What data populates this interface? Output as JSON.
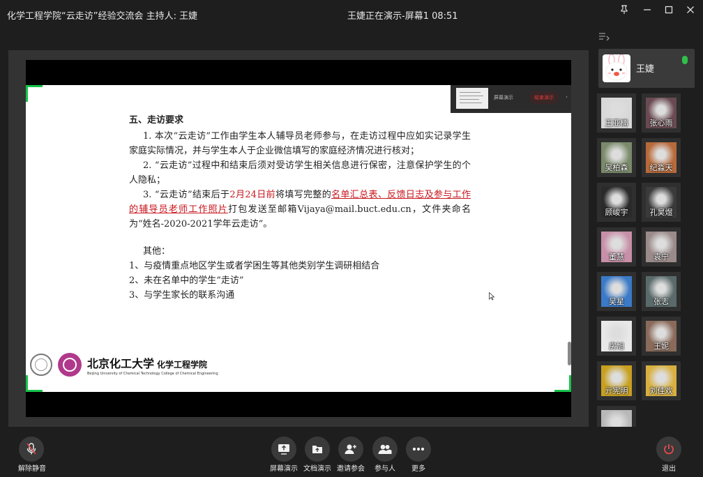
{
  "app": {
    "meeting_title": "化学工程学院“云走访”经验交流会   主持人: 王婕",
    "window_title": "王婕正在演示-屏幕1 08:51",
    "win_icons": {
      "pin": "pin-icon",
      "minimize": "minimize-icon",
      "maximize": "maximize-icon",
      "close": "close-icon"
    }
  },
  "slide": {
    "heading": "五、走访要求",
    "p1": "1. 本次“云走访”工作由学生本人辅导员老师参与，在走访过程中应如实记录学生家庭实际情况，并与学生本人于企业微信填写的家庭经济情况进行核对；",
    "p2": "2. “云走访”过程中和结束后须对受访学生相关信息进行保密，注意保护学生的个人隐私；",
    "p3_a": "3. “云走访”结束后于",
    "p3_date": "2月24日前",
    "p3_b": "将填写完整的",
    "p3_link": "名单汇总表、反馈日志及参与工作的辅导员老师工作照片",
    "p3_c": "打包发送至邮箱Vijaya@mail.buct.edu.cn，文件夹命名为“姓名-2020-2021学年云走访”。",
    "others_label": "其他：",
    "others": [
      "1、与疫情重点地区学生或者学困生等其他类别学生调研相结合",
      "2、未在名单中的学生“走访”",
      "3、与学生家长的联系沟通"
    ],
    "university_cn": "北京化工大学",
    "college_cn": "化学工程学院",
    "university_en": "Beijing University of Chemical Technology   College of Chemical Engineering",
    "mini_label": "屏幕演示",
    "mini_stop": "结束演示"
  },
  "host": {
    "name": "王婕"
  },
  "participants": [
    {
      "name": "王亚楠",
      "color": "#d8d8d8"
    },
    {
      "name": "张心雨",
      "color": "#6a4a52"
    },
    {
      "name": "吴柏森",
      "color": "#7a8a6a"
    },
    {
      "name": "纪淼天",
      "color": "#b86a3a"
    },
    {
      "name": "顾峻宇",
      "color": "#2a2a2a"
    },
    {
      "name": "孔昊煜",
      "color": "#3a3a3a"
    },
    {
      "name": "董慧",
      "color": "#c890a8"
    },
    {
      "name": "袁宁",
      "color": "#9a8a8a"
    },
    {
      "name": "吴星",
      "color": "#3a7ac8"
    },
    {
      "name": "张志",
      "color": "#5a6a6a"
    },
    {
      "name": "房旭",
      "color": "#e8e8e8"
    },
    {
      "name": "王妮",
      "color": "#8a6a5a"
    },
    {
      "name": "亓宪明",
      "color": "#c8a020"
    },
    {
      "name": "刘佳欢",
      "color": "#d8b040"
    },
    {
      "name": "",
      "color": "#b8b8b8"
    }
  ],
  "toolbar": {
    "unmute": "解除静音",
    "screen_share": "屏幕演示",
    "doc_share": "文档演示",
    "invite": "邀请参会",
    "participants": "参与人",
    "more": "更多",
    "leave": "退出"
  },
  "colors": {
    "accent_green": "#19c24a",
    "leave_red": "#e84a4a",
    "slide_red": "#c8161d"
  }
}
